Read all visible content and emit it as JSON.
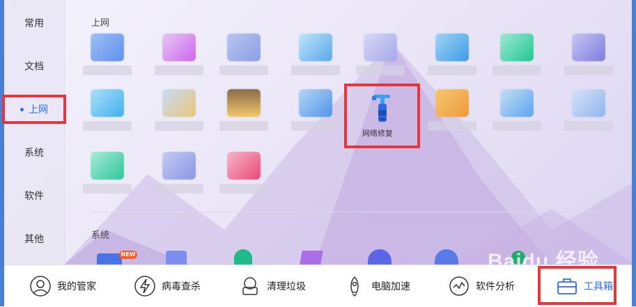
{
  "sidebar": {
    "items": [
      {
        "label": "常用"
      },
      {
        "label": "文档"
      },
      {
        "label": "上网",
        "active": true
      },
      {
        "label": "系统"
      },
      {
        "label": "软件"
      },
      {
        "label": "其他"
      }
    ]
  },
  "sections": {
    "internet_title": "上网",
    "system_title": "系统"
  },
  "tools": {
    "network_repair": "网络修复"
  },
  "badges": {
    "new": "NEW"
  },
  "watermark": "Baidu 经验",
  "bottom_bar": {
    "items": [
      {
        "label": "我的管家",
        "icon": "avatar-icon"
      },
      {
        "label": "病毒查杀",
        "icon": "lightning-shield-icon"
      },
      {
        "label": "清理垃圾",
        "icon": "broom-icon"
      },
      {
        "label": "电脑加速",
        "icon": "rocket-icon"
      },
      {
        "label": "软件分析",
        "icon": "chart-circle-icon"
      },
      {
        "label": "工具箱",
        "icon": "toolbox-icon",
        "active": true
      }
    ]
  },
  "colors": {
    "accent": "#2d6be4",
    "highlight": "#e5363c",
    "window_edge": "#4a7fd4"
  }
}
